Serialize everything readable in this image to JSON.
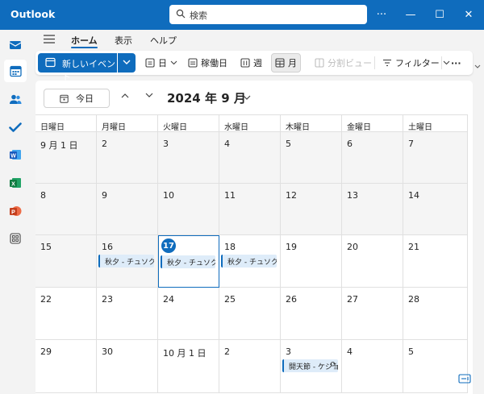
{
  "app": {
    "title": "Outlook"
  },
  "search": {
    "placeholder": "検索"
  },
  "window": {
    "more": "···",
    "minimize": "—",
    "maximize": "☐",
    "close": "✕"
  },
  "tabs": {
    "home": "ホーム",
    "view": "表示",
    "help": "ヘルプ"
  },
  "commands": {
    "new_event": "新しいイベント",
    "day": "日",
    "workweek": "稼働日",
    "week": "週",
    "month": "月",
    "split": "分割ビュー",
    "filter": "フィルター",
    "more": "···"
  },
  "nav": {
    "today": "今日",
    "month_title": "2024 年 9 月"
  },
  "weekdays": [
    "日曜日",
    "月曜日",
    "火曜日",
    "水曜日",
    "木曜日",
    "金曜日",
    "土曜日"
  ],
  "weeks": [
    [
      {
        "d": "9 月 1 日",
        "muted": true
      },
      {
        "d": "2",
        "muted": true
      },
      {
        "d": "3",
        "muted": true
      },
      {
        "d": "4",
        "muted": true
      },
      {
        "d": "5",
        "muted": true
      },
      {
        "d": "6",
        "muted": true
      },
      {
        "d": "7",
        "muted": true
      }
    ],
    [
      {
        "d": "8",
        "muted": true
      },
      {
        "d": "9",
        "muted": true
      },
      {
        "d": "10",
        "muted": true
      },
      {
        "d": "11",
        "muted": true
      },
      {
        "d": "12",
        "muted": true
      },
      {
        "d": "13",
        "muted": true
      },
      {
        "d": "14",
        "muted": true
      }
    ],
    [
      {
        "d": "15",
        "muted": true
      },
      {
        "d": "16",
        "muted": true,
        "event": "秋夕 - チュソク (韓国)"
      },
      {
        "d": "17",
        "today": true,
        "event": "秋夕 - チュソク (韓国)"
      },
      {
        "d": "18",
        "event": "秋夕 - チュソク (韓国)"
      },
      {
        "d": "19"
      },
      {
        "d": "20"
      },
      {
        "d": "21"
      }
    ],
    [
      {
        "d": "22"
      },
      {
        "d": "23"
      },
      {
        "d": "24"
      },
      {
        "d": "25"
      },
      {
        "d": "26"
      },
      {
        "d": "27"
      },
      {
        "d": "28"
      }
    ],
    [
      {
        "d": "29"
      },
      {
        "d": "30"
      },
      {
        "d": "10 月 1 日"
      },
      {
        "d": "2"
      },
      {
        "d": "3",
        "event": "開天節 - ケジョル",
        "recurring": true
      },
      {
        "d": "4"
      },
      {
        "d": "5"
      }
    ]
  ],
  "colors": {
    "brand": "#0f6cbd",
    "event_bg": "#deecf9",
    "muted_bg": "#f5f5f5"
  }
}
